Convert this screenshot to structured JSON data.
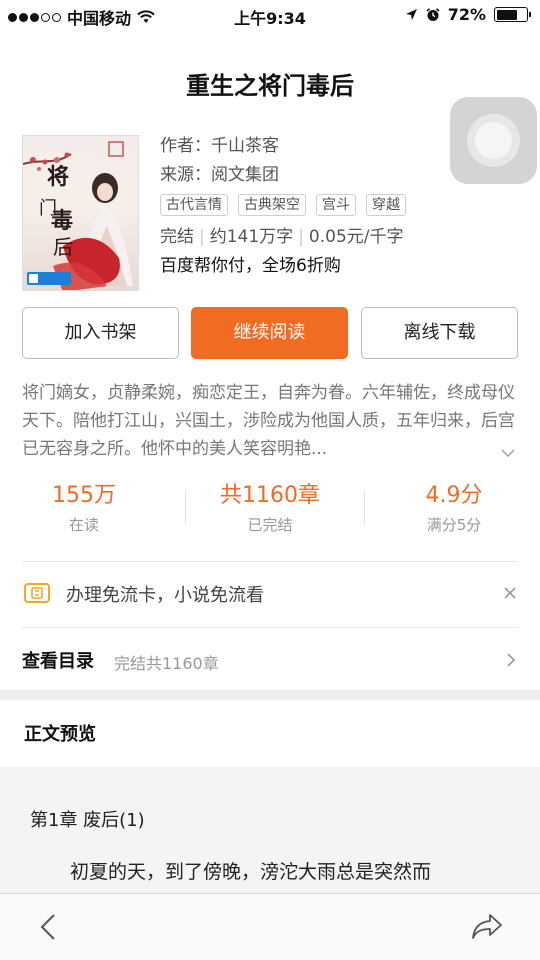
{
  "status_bar": {
    "carrier": "中国移动",
    "time": "上午9:34",
    "battery": "72%",
    "battery_level": 0.72,
    "signal_bars": 3,
    "signal_total": 5
  },
  "book": {
    "title": "重生之将门毒后",
    "author_label": "作者：",
    "author": "千山茶客",
    "source_label": "来源：",
    "source": "阅文集团",
    "tags": [
      "古代言情",
      "古典架空",
      "宫斗",
      "穿越"
    ],
    "status": "完结",
    "word_count": "约141万字",
    "price": "0.05元/千字",
    "promo": "百度帮你付，全场6折购"
  },
  "buttons": {
    "add_shelf": "加入书架",
    "continue": "继续阅读",
    "offline": "离线下载"
  },
  "synopsis": "将门嫡女，贞静柔婉，痴恋定王，自奔为眷。六年辅佐，终成母仪天下。陪他打江山，兴国土，涉险成为他国人质，五年归来，后宫已无容身之所。他怀中的美人笑容明艳...",
  "metrics": [
    {
      "value": "155万",
      "label": "在读"
    },
    {
      "value": "共1160章",
      "label": "已完结"
    },
    {
      "value": "4.9分",
      "label": "满分5分"
    }
  ],
  "free_card": {
    "text": "办理免流卡，小说免流看"
  },
  "catalog": {
    "title": "查看目录",
    "subtitle": "完结共1160章"
  },
  "preview": {
    "heading": "正文预览",
    "chapter": "第1章 废后(1)",
    "first_line": "初夏的天，到了傍晚，滂沱大雨总是突然而"
  },
  "colors": {
    "accent": "#f26b22",
    "free_card_icon": "#f5a623"
  }
}
